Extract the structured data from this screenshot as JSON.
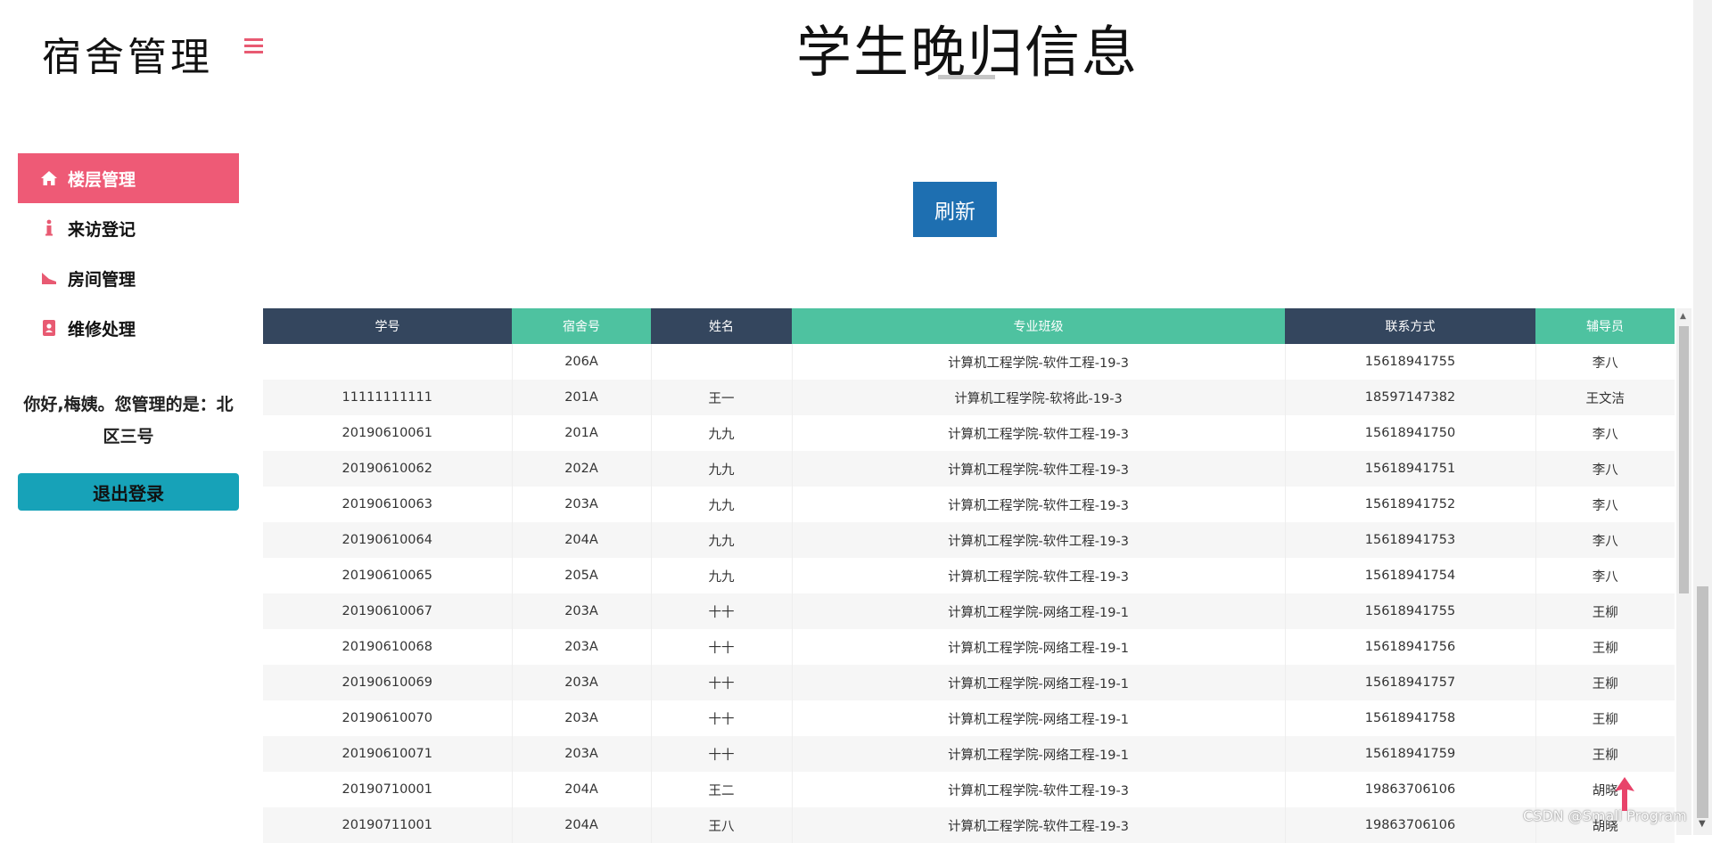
{
  "app": {
    "brand": "宿舍管理",
    "title": "学生晚归信息"
  },
  "sidebar": {
    "items": [
      {
        "label": "楼层管理",
        "icon": "home-icon",
        "active": true
      },
      {
        "label": "来访登记",
        "icon": "info-icon",
        "active": false
      },
      {
        "label": "房间管理",
        "icon": "bed-icon",
        "active": false
      },
      {
        "label": "维修处理",
        "icon": "contact-book-icon",
        "active": false
      }
    ],
    "greeting": "你好,梅姨。您管理的是：北区三号",
    "logout_label": "退出登录"
  },
  "toolbar": {
    "refresh_label": "刷新"
  },
  "table": {
    "headers": [
      "学号",
      "宿舍号",
      "姓名",
      "专业班级",
      "联系方式",
      "辅导员"
    ],
    "rows": [
      [
        "",
        "206A",
        "",
        "计算机工程学院-软件工程-19-3",
        "15618941755",
        "李八"
      ],
      [
        "11111111111",
        "201A",
        "王一",
        "计算机工程学院-软将此-19-3",
        "18597147382",
        "王文洁"
      ],
      [
        "20190610061",
        "201A",
        "九九",
        "计算机工程学院-软件工程-19-3",
        "15618941750",
        "李八"
      ],
      [
        "20190610062",
        "202A",
        "九九",
        "计算机工程学院-软件工程-19-3",
        "15618941751",
        "李八"
      ],
      [
        "20190610063",
        "203A",
        "九九",
        "计算机工程学院-软件工程-19-3",
        "15618941752",
        "李八"
      ],
      [
        "20190610064",
        "204A",
        "九九",
        "计算机工程学院-软件工程-19-3",
        "15618941753",
        "李八"
      ],
      [
        "20190610065",
        "205A",
        "九九",
        "计算机工程学院-软件工程-19-3",
        "15618941754",
        "李八"
      ],
      [
        "20190610067",
        "203A",
        "十十",
        "计算机工程学院-网络工程-19-1",
        "15618941755",
        "王柳"
      ],
      [
        "20190610068",
        "203A",
        "十十",
        "计算机工程学院-网络工程-19-1",
        "15618941756",
        "王柳"
      ],
      [
        "20190610069",
        "203A",
        "十十",
        "计算机工程学院-网络工程-19-1",
        "15618941757",
        "王柳"
      ],
      [
        "20190610070",
        "203A",
        "十十",
        "计算机工程学院-网络工程-19-1",
        "15618941758",
        "王柳"
      ],
      [
        "20190610071",
        "203A",
        "十十",
        "计算机工程学院-网络工程-19-1",
        "15618941759",
        "王柳"
      ],
      [
        "20190710001",
        "204A",
        "王二",
        "计算机工程学院-软件工程-19-3",
        "19863706106",
        "胡晓"
      ],
      [
        "20190711001",
        "204A",
        "王八",
        "计算机工程学院-软件工程-19-3",
        "19863706106",
        "胡晓"
      ]
    ]
  },
  "watermark": "CSDN @Small Program",
  "colors": {
    "accent_pink": "#ee5a76",
    "header_dark": "#34465e",
    "header_teal": "#4ec2a0",
    "refresh_blue": "#1e6fb1",
    "logout_teal": "#17a2b8"
  }
}
